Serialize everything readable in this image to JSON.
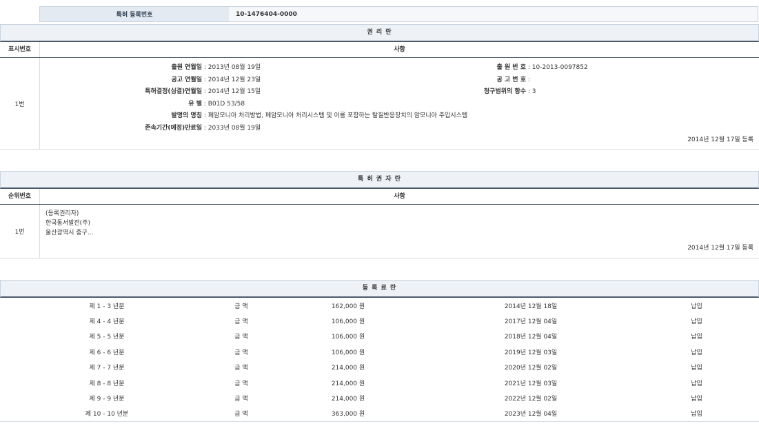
{
  "registration": {
    "label": "특허 등록번호",
    "value": "10-1476404-0000"
  },
  "rights_section": {
    "title": "권 리 란",
    "col_num_label": "표시번호",
    "col_content_label": "사항",
    "row_num": "1번",
    "left_fields": [
      {
        "key": "출원 연월일",
        "value": "2013년 08월 19일"
      },
      {
        "key": "공고 연월일",
        "value": "2014년 12월 23일"
      },
      {
        "key": "특허결정(심결)연월일",
        "value": "2014년 12월 15일"
      },
      {
        "key": "유 별",
        "value": "B01D 53/58"
      },
      {
        "key": "발명의 명칭",
        "value": "폐암모니아 처리방법, 폐암모니아 처리시스템 및 이를 포함하는 탈질반응장치의 암모니아 주입시스템"
      },
      {
        "key": "존속기간(예정)만료일",
        "value": "2033년 08월 19일"
      }
    ],
    "right_fields": [
      {
        "key": "출 원 번 호",
        "value": "10-2013-0097852"
      },
      {
        "key": "공 고 번 호",
        "value": ""
      },
      {
        "key": "청구범위의 항수",
        "value": "3"
      }
    ],
    "registered_on": "2014년 12월 17일 등록"
  },
  "patentee_section": {
    "title": "특 허 권 자 란",
    "col_num_label": "순위번호",
    "col_content_label": "사항",
    "row_num": "1번",
    "lines": [
      "(등록권리자)",
      "한국동서발전(주)",
      "울산광역시 중구..."
    ],
    "registered_on": "2014년 12월 17일 등록"
  },
  "fee_section": {
    "title": "등 록 료 란",
    "rows": [
      {
        "period": "제 1 - 3 년분",
        "amount_label": "금 액",
        "amount": "162,000 원",
        "date": "2014년 12월 18일",
        "status": "납입"
      },
      {
        "period": "제 4 - 4 년분",
        "amount_label": "금 액",
        "amount": "106,000 원",
        "date": "2017년 12월 04일",
        "status": "납입"
      },
      {
        "period": "제 5 - 5 년분",
        "amount_label": "금 액",
        "amount": "106,000 원",
        "date": "2018년 12월 04일",
        "status": "납입"
      },
      {
        "period": "제 6 - 6 년분",
        "amount_label": "금 액",
        "amount": "106,000 원",
        "date": "2019년 12월 03일",
        "status": "납입"
      },
      {
        "period": "제 7 - 7 년분",
        "amount_label": "금 액",
        "amount": "214,000 원",
        "date": "2020년 12월 02일",
        "status": "납입"
      },
      {
        "period": "제 8 - 8 년분",
        "amount_label": "금 액",
        "amount": "214,000 원",
        "date": "2021년 12월 03일",
        "status": "납입"
      },
      {
        "period": "제 9 - 9 년분",
        "amount_label": "금 액",
        "amount": "214,000 원",
        "date": "2022년 12월 02일",
        "status": "납입"
      },
      {
        "period": "제 10 - 10 년분",
        "amount_label": "금 액",
        "amount": "363,000 원",
        "date": "2023년 12월 04일",
        "status": "납입"
      }
    ]
  }
}
